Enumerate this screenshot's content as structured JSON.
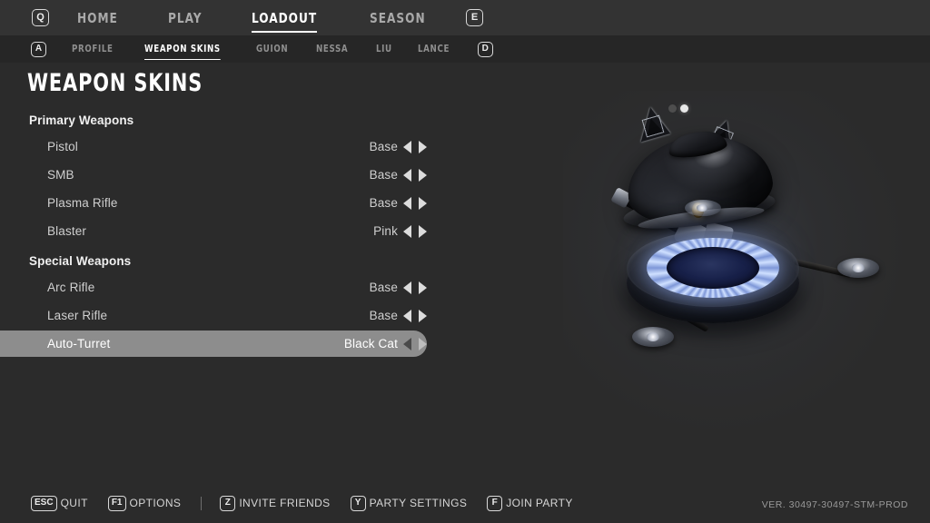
{
  "topnav": {
    "left_key": "Q",
    "right_key": "E",
    "items": [
      {
        "label": "HOME",
        "active": false
      },
      {
        "label": "PLAY",
        "active": false
      },
      {
        "label": "LOADOUT",
        "active": true
      },
      {
        "label": "SEASON",
        "active": false
      }
    ]
  },
  "subnav": {
    "left_key": "A",
    "right_key": "D",
    "items": [
      {
        "label": "PROFILE",
        "active": false
      },
      {
        "label": "WEAPON SKINS",
        "active": true
      },
      {
        "label": "GUION",
        "active": false
      },
      {
        "label": "NESSA",
        "active": false
      },
      {
        "label": "LIU",
        "active": false
      },
      {
        "label": "LANCE",
        "active": false
      }
    ]
  },
  "page": {
    "title": "WEAPON SKINS"
  },
  "groups": [
    {
      "heading": "Primary Weapons",
      "rows": [
        {
          "label": "Pistol",
          "value": "Base",
          "selected": false
        },
        {
          "label": "SMB",
          "value": "Base",
          "selected": false
        },
        {
          "label": "Plasma Rifle",
          "value": "Base",
          "selected": false
        },
        {
          "label": "Blaster",
          "value": "Pink",
          "selected": false
        }
      ]
    },
    {
      "heading": "Special Weapons",
      "rows": [
        {
          "label": "Arc Rifle",
          "value": "Base",
          "selected": false
        },
        {
          "label": "Laser Rifle",
          "value": "Base",
          "selected": false
        },
        {
          "label": "Auto-Turret",
          "value": "Black Cat",
          "selected": true
        }
      ]
    }
  ],
  "preview": {
    "model_name": "auto-turret-black-cat",
    "pager": {
      "total": 2,
      "current": 2
    }
  },
  "footer": {
    "actions": [
      {
        "key": "ESC",
        "label": "QUIT",
        "separator_after": true
      },
      {
        "key": "F1",
        "label": "OPTIONS",
        "separator_after": true
      },
      {
        "key": "Z",
        "label": "INVITE FRIENDS",
        "separator_after": false
      },
      {
        "key": "Y",
        "label": "PARTY SETTINGS",
        "separator_after": false
      },
      {
        "key": "F",
        "label": "JOIN PARTY",
        "separator_after": false
      }
    ],
    "version": "VER. 30497-30497-STM-PROD"
  },
  "colors": {
    "background": "#2b2b2b",
    "topnav_bg": "#333333",
    "subnav_bg": "#262626",
    "accent_text": "#ffffff",
    "muted_text": "#8f8f8f",
    "selection_bg": "#8d8d8d",
    "glow": "#9ab4ff"
  }
}
